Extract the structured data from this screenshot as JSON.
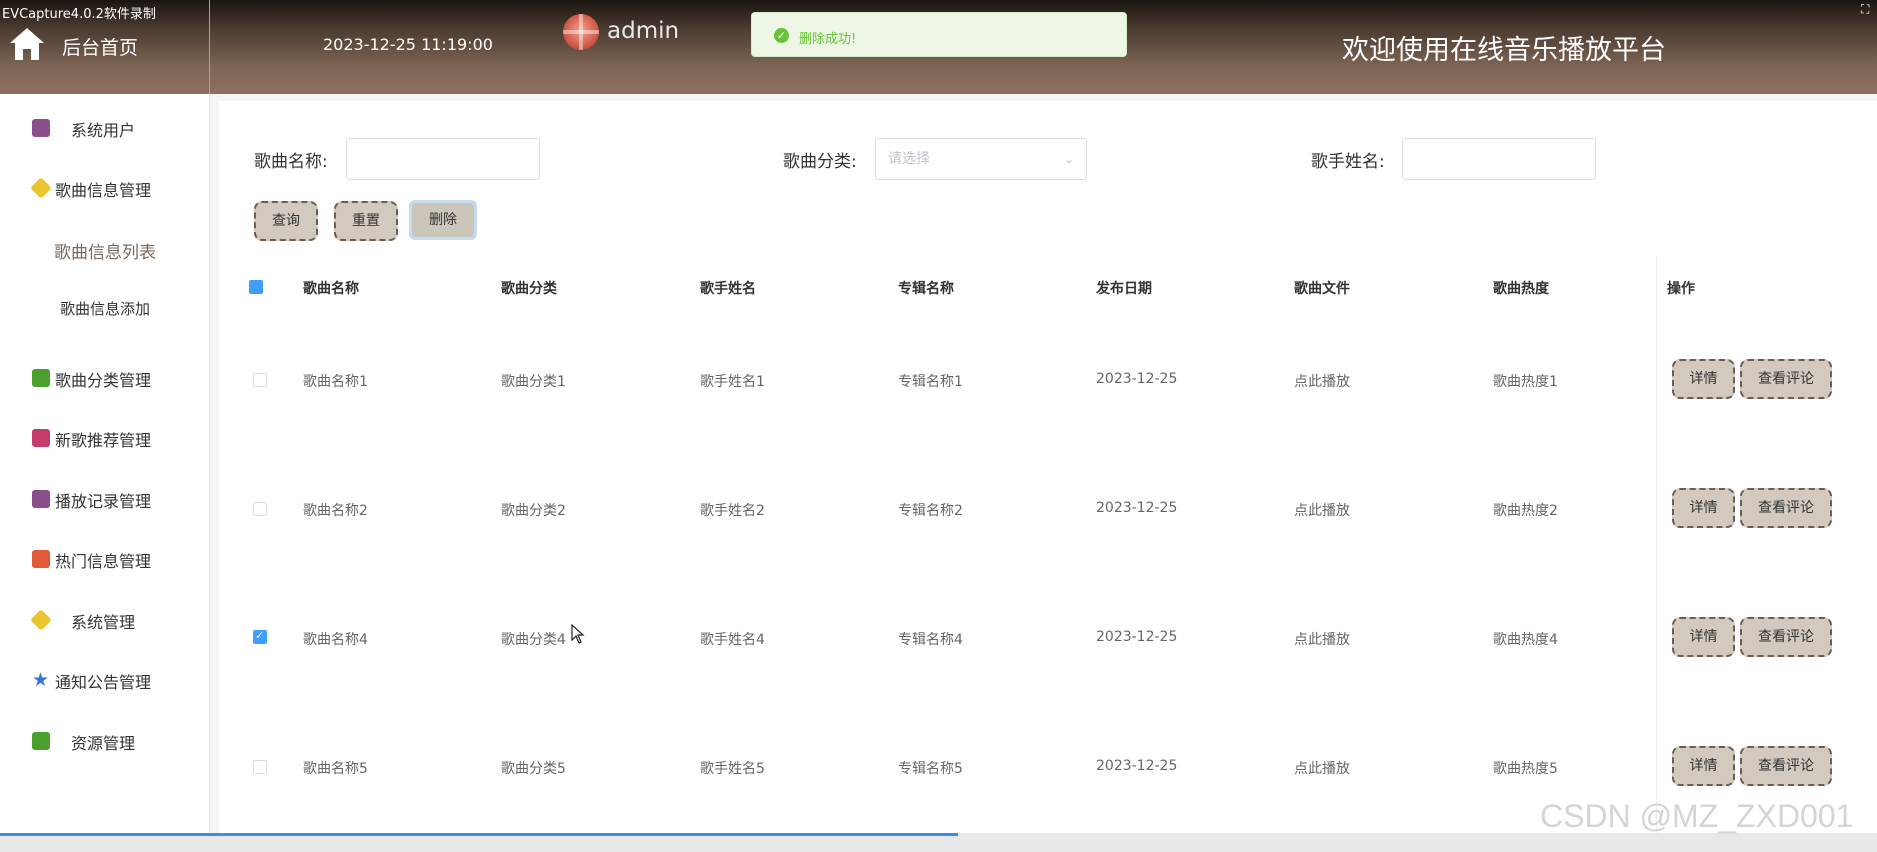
{
  "recorder": {
    "label": "EVCapture4.0.2软件录制"
  },
  "header": {
    "home_label": "后台首页",
    "datetime": "2023-12-25 11:19:00",
    "user": "admin",
    "toast": "删除成功!",
    "welcome": "欢迎使用在线音乐播放平台"
  },
  "sidebar": {
    "items": [
      {
        "label": "系统用户",
        "icon": "user-box-icon",
        "color": "#8a4f8a"
      },
      {
        "label": "歌曲信息管理",
        "icon": "cube-icon",
        "color": "#e8c62c"
      },
      {
        "label": "歌曲分类管理",
        "icon": "chat-icon",
        "color": "#4aa02c"
      },
      {
        "label": "新歌推荐管理",
        "icon": "doc-star-icon",
        "color": "#c43c6c"
      },
      {
        "label": "播放记录管理",
        "icon": "box-icon",
        "color": "#8a4f8a"
      },
      {
        "label": "热门信息管理",
        "icon": "grid-icon",
        "color": "#e05a3a"
      },
      {
        "label": "系统管理",
        "icon": "cube-icon",
        "color": "#e8c62c"
      },
      {
        "label": "通知公告管理",
        "icon": "star-icon",
        "color": "#3a78d8"
      },
      {
        "label": "资源管理",
        "icon": "chat-icon",
        "color": "#4aa02c"
      }
    ],
    "sub_items": [
      "歌曲信息列表",
      "歌曲信息添加"
    ]
  },
  "filters": {
    "song_name_label": "歌曲名称:",
    "category_label": "歌曲分类:",
    "category_placeholder": "请选择",
    "singer_label": "歌手姓名:"
  },
  "buttons": {
    "query": "查询",
    "reset": "重置",
    "delete": "删除"
  },
  "table": {
    "headers": [
      "歌曲名称",
      "歌曲分类",
      "歌手姓名",
      "专辑名称",
      "发布日期",
      "歌曲文件",
      "歌曲热度",
      "操作"
    ],
    "rows": [
      {
        "checked": false,
        "cells": [
          "歌曲名称1",
          "歌曲分类1",
          "歌手姓名1",
          "专辑名称1",
          "2023-12-25",
          "点此播放",
          "歌曲热度1"
        ]
      },
      {
        "checked": false,
        "cells": [
          "歌曲名称2",
          "歌曲分类2",
          "歌手姓名2",
          "专辑名称2",
          "2023-12-25",
          "点此播放",
          "歌曲热度2"
        ]
      },
      {
        "checked": true,
        "cells": [
          "歌曲名称4",
          "歌曲分类4",
          "歌手姓名4",
          "专辑名称4",
          "2023-12-25",
          "点此播放",
          "歌曲热度4"
        ]
      },
      {
        "checked": false,
        "cells": [
          "歌曲名称5",
          "歌曲分类5",
          "歌手姓名5",
          "专辑名称5",
          "2023-12-25",
          "点此播放",
          "歌曲热度5"
        ]
      }
    ],
    "row_actions": [
      "详情",
      "查看评论"
    ]
  },
  "watermark": "CSDN @MZ_ZXD001"
}
